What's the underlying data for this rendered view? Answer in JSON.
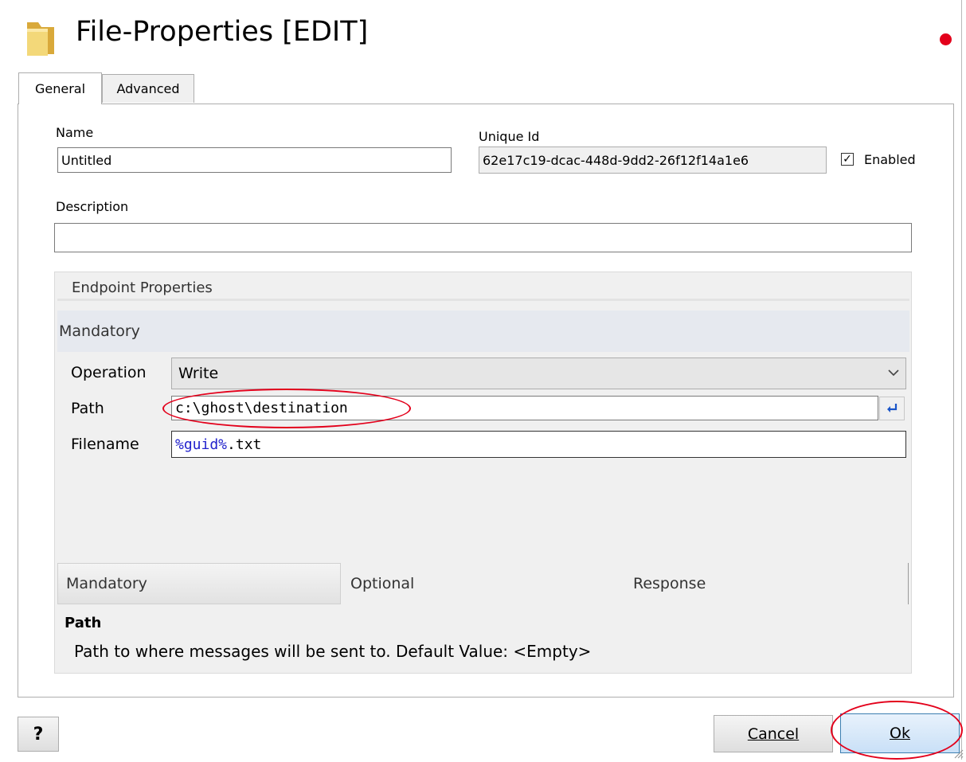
{
  "window": {
    "title": "File-Properties [EDIT]"
  },
  "tabs": [
    {
      "label": "General"
    },
    {
      "label": "Advanced"
    }
  ],
  "general": {
    "name_label": "Name",
    "name_value": "Untitled",
    "unique_id_label": "Unique Id",
    "unique_id_value": "62e17c19-dcac-448d-9dd2-26f12f14a1e6",
    "enabled_label": "Enabled",
    "enabled_checked": true,
    "description_label": "Description",
    "description_value": ""
  },
  "endpoint": {
    "header": "Endpoint Properties",
    "section": "Mandatory",
    "rows": [
      {
        "label": "Operation",
        "value": "Write"
      },
      {
        "label": "Path",
        "value": "c:\\ghost\\destination"
      },
      {
        "label": "Filename",
        "value_token": "%guid%",
        "value_rest": ".txt"
      }
    ],
    "bottom_tabs": [
      "Mandatory",
      "Optional",
      "Response"
    ],
    "help_title": "Path",
    "help_text": "Path to where messages will be sent to. Default Value: <Empty>"
  },
  "buttons": {
    "help": "?",
    "cancel": "Cancel",
    "ok": "Ok"
  },
  "colors": {
    "annotation": "#e3001b",
    "token": "#2222cc",
    "enter_icon": "#1a55c8"
  },
  "icons": {
    "title": "folder-icon",
    "enter": "enter-arrow-icon",
    "chevron": "chevron-down-icon",
    "checkbox": "checkmark-icon"
  }
}
